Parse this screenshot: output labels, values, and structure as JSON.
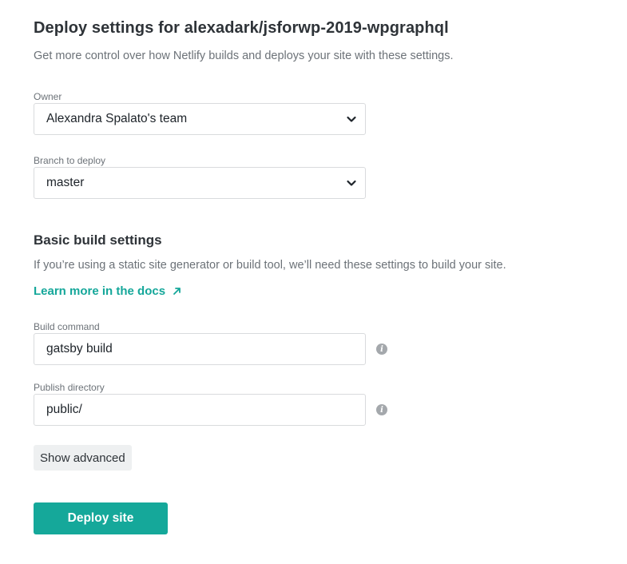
{
  "header": {
    "title": "Deploy settings for alexadark/jsforwp-2019-wpgraphql",
    "subtitle": "Get more control over how Netlify builds and deploys your site with these settings."
  },
  "owner": {
    "label": "Owner",
    "value": "Alexandra Spalato's team",
    "icon": "chevron-down-icon"
  },
  "branch": {
    "label": "Branch to deploy",
    "value": "master",
    "icon": "chevron-down-icon"
  },
  "build_settings": {
    "title": "Basic build settings",
    "description": "If you’re using a static site generator or build tool, we’ll need these settings to build your site.",
    "docs_link": "Learn more in the docs",
    "docs_icon": "external-arrow-icon"
  },
  "build_command": {
    "label": "Build command",
    "value": "gatsby build",
    "info_icon": "info-icon"
  },
  "publish_directory": {
    "label": "Publish directory",
    "value": "public/",
    "info_icon": "info-icon"
  },
  "actions": {
    "show_advanced": "Show advanced",
    "deploy": "Deploy site"
  },
  "colors": {
    "accent": "#15a89a",
    "text": "#2e3338",
    "muted": "#6c7278",
    "border": "#d9dbdd"
  }
}
